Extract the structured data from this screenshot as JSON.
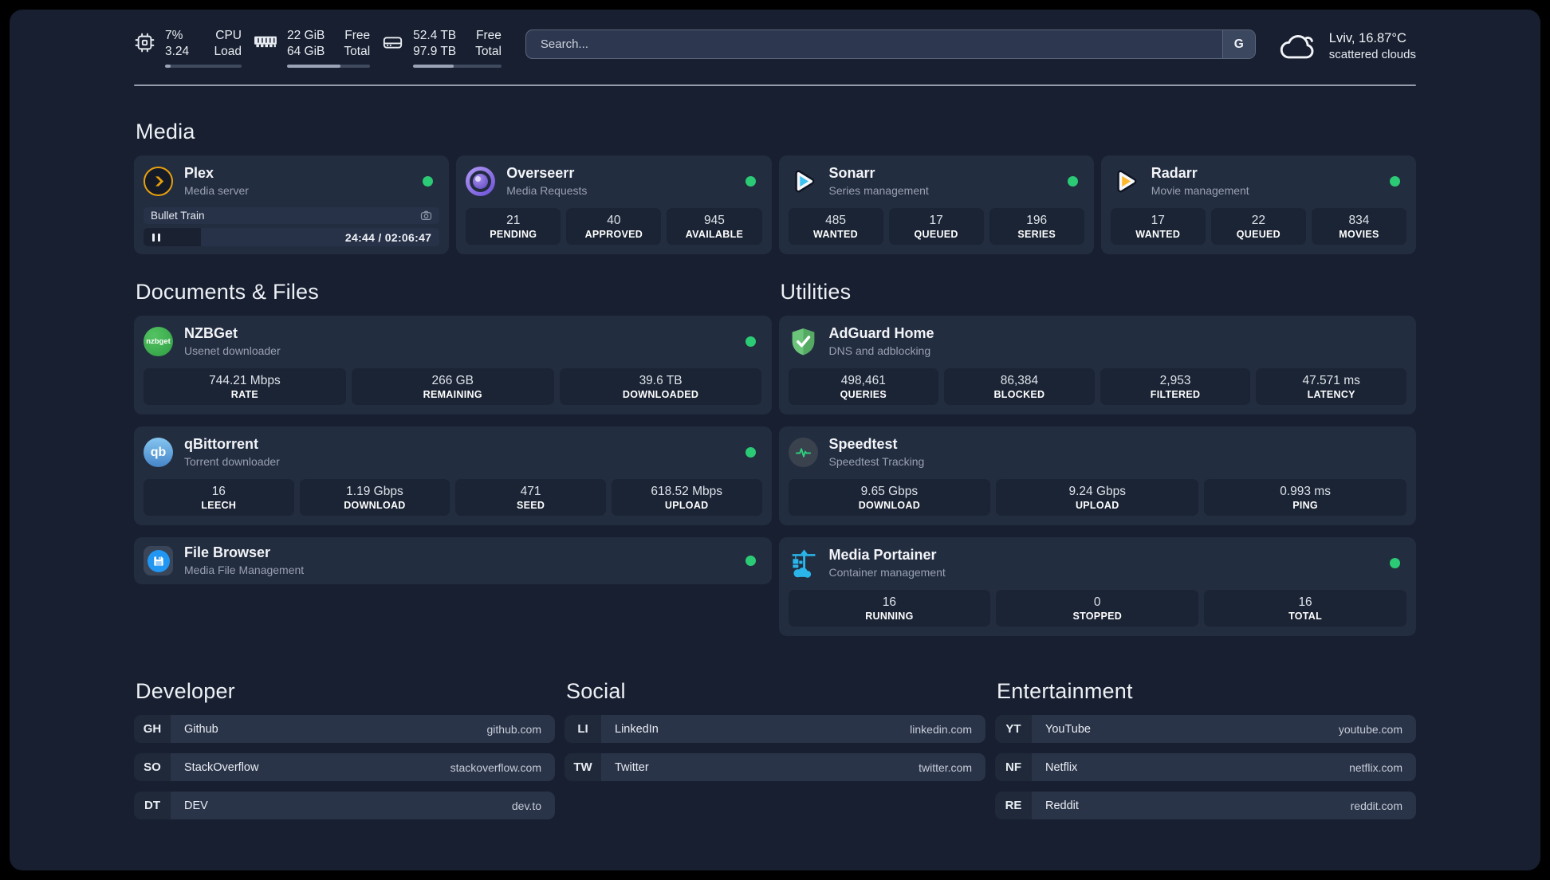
{
  "topbar": {
    "cpu": {
      "values": [
        "7%",
        "3.24"
      ],
      "labels": [
        "CPU",
        "Load"
      ],
      "progress_pct": 7
    },
    "ram": {
      "values": [
        "22 GiB",
        "64 GiB"
      ],
      "labels": [
        "Free",
        "Total"
      ],
      "progress_pct": 64
    },
    "disk": {
      "values": [
        "52.4 TB",
        "97.9 TB"
      ],
      "labels": [
        "Free",
        "Total"
      ],
      "progress_pct": 46
    },
    "search": {
      "placeholder": "Search...",
      "engine_button_label": "G"
    },
    "weather": {
      "location_temperature": "Lviv, 16.87°C",
      "condition": "scattered clouds"
    }
  },
  "colors": {
    "status_online": "#2bca75",
    "plex_accent": "#e8a00c",
    "sonarr_accent": "#3ec1f0",
    "radarr_accent": "#ffb72b",
    "portainer_accent": "#2ab6ea"
  },
  "sections": {
    "media": {
      "title": "Media",
      "plex": {
        "name": "Plex",
        "description": "Media server",
        "status": "online",
        "now_playing": "Bullet Train",
        "elapsed_total": "24:44 / 02:06:47",
        "progress_pct": 19.5
      },
      "overseerr": {
        "name": "Overseerr",
        "description": "Media Requests",
        "status": "online",
        "stats": [
          {
            "value": "21",
            "label": "PENDING"
          },
          {
            "value": "40",
            "label": "APPROVED"
          },
          {
            "value": "945",
            "label": "AVAILABLE"
          }
        ]
      },
      "sonarr": {
        "name": "Sonarr",
        "description": "Series management",
        "status": "online",
        "stats": [
          {
            "value": "485",
            "label": "WANTED"
          },
          {
            "value": "17",
            "label": "QUEUED"
          },
          {
            "value": "196",
            "label": "SERIES"
          }
        ]
      },
      "radarr": {
        "name": "Radarr",
        "description": "Movie management",
        "status": "online",
        "stats": [
          {
            "value": "17",
            "label": "WANTED"
          },
          {
            "value": "22",
            "label": "QUEUED"
          },
          {
            "value": "834",
            "label": "MOVIES"
          }
        ]
      }
    },
    "documents_files": {
      "title": "Documents & Files",
      "nzbget": {
        "name": "NZBGet",
        "description": "Usenet downloader",
        "status": "online",
        "logo_text": "nzbget",
        "stats": [
          {
            "value": "744.21 Mbps",
            "label": "RATE"
          },
          {
            "value": "266 GB",
            "label": "REMAINING"
          },
          {
            "value": "39.6 TB",
            "label": "DOWNLOADED"
          }
        ]
      },
      "qbittorrent": {
        "name": "qBittorrent",
        "description": "Torrent downloader",
        "status": "online",
        "logo_text": "qb",
        "stats": [
          {
            "value": "16",
            "label": "LEECH"
          },
          {
            "value": "1.19 Gbps",
            "label": "DOWNLOAD"
          },
          {
            "value": "471",
            "label": "SEED"
          },
          {
            "value": "618.52 Mbps",
            "label": "UPLOAD"
          }
        ]
      },
      "file_browser": {
        "name": "File Browser",
        "description": "Media File Management",
        "status": "online"
      }
    },
    "utilities": {
      "title": "Utilities",
      "adguard_home": {
        "name": "AdGuard Home",
        "description": "DNS and adblocking",
        "stats": [
          {
            "value": "498,461",
            "label": "QUERIES"
          },
          {
            "value": "86,384",
            "label": "BLOCKED"
          },
          {
            "value": "2,953",
            "label": "FILTERED"
          },
          {
            "value": "47.571 ms",
            "label": "LATENCY"
          }
        ]
      },
      "speedtest": {
        "name": "Speedtest",
        "description": "Speedtest Tracking",
        "stats": [
          {
            "value": "9.65 Gbps",
            "label": "DOWNLOAD"
          },
          {
            "value": "9.24 Gbps",
            "label": "UPLOAD"
          },
          {
            "value": "0.993 ms",
            "label": "PING"
          }
        ]
      },
      "media_portainer": {
        "name": "Media Portainer",
        "description": "Container management",
        "status": "online",
        "stats": [
          {
            "value": "16",
            "label": "RUNNING"
          },
          {
            "value": "0",
            "label": "STOPPED"
          },
          {
            "value": "16",
            "label": "TOTAL"
          }
        ]
      }
    },
    "developer": {
      "title": "Developer",
      "items": [
        {
          "abbr": "GH",
          "name": "Github",
          "url": "github.com"
        },
        {
          "abbr": "SO",
          "name": "StackOverflow",
          "url": "stackoverflow.com"
        },
        {
          "abbr": "DT",
          "name": "DEV",
          "url": "dev.to"
        }
      ]
    },
    "social": {
      "title": "Social",
      "items": [
        {
          "abbr": "LI",
          "name": "LinkedIn",
          "url": "linkedin.com"
        },
        {
          "abbr": "TW",
          "name": "Twitter",
          "url": "twitter.com"
        }
      ]
    },
    "entertainment": {
      "title": "Entertainment",
      "items": [
        {
          "abbr": "YT",
          "name": "YouTube",
          "url": "youtube.com"
        },
        {
          "abbr": "NF",
          "name": "Netflix",
          "url": "netflix.com"
        },
        {
          "abbr": "RE",
          "name": "Reddit",
          "url": "reddit.com"
        }
      ]
    }
  }
}
